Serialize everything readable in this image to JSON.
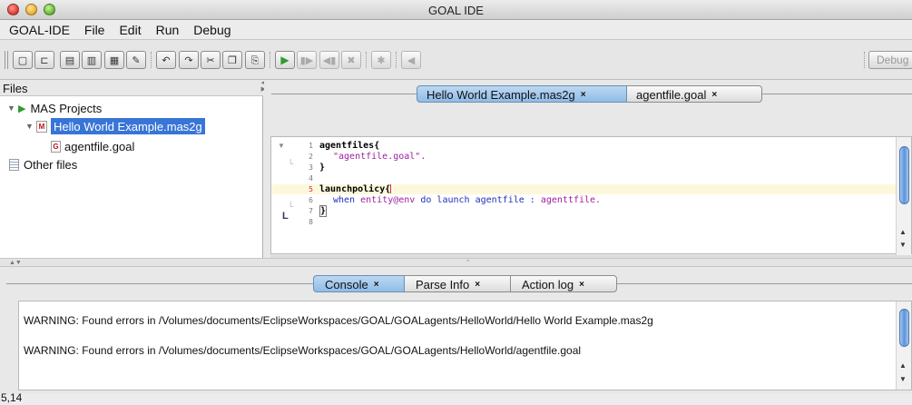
{
  "window": {
    "title": "GOAL IDE"
  },
  "menubar": {
    "items": [
      "GOAL-IDE",
      "File",
      "Edit",
      "Run",
      "Debug"
    ]
  },
  "toolbar": {
    "buttons": [
      {
        "icon": "new-file-icon",
        "glyph": "▢"
      },
      {
        "icon": "open-folder-icon",
        "glyph": "⊏"
      },
      {
        "icon": "save-icon",
        "glyph": "▤"
      },
      {
        "icon": "save-as-icon",
        "glyph": "▥"
      },
      {
        "icon": "save-all-icon",
        "glyph": "▦"
      },
      {
        "icon": "edit-icon",
        "glyph": "✎"
      },
      {
        "icon": "undo-icon",
        "glyph": "↶"
      },
      {
        "icon": "redo-icon",
        "glyph": "↷"
      },
      {
        "icon": "cut-icon",
        "glyph": "✂"
      },
      {
        "icon": "copy-icon",
        "glyph": "❐"
      },
      {
        "icon": "paste-icon",
        "glyph": "⎘"
      },
      {
        "icon": "run-icon",
        "glyph": "▶"
      },
      {
        "icon": "step-icon",
        "glyph": "▮▶"
      },
      {
        "icon": "back-step-icon",
        "glyph": "◀▮"
      },
      {
        "icon": "kill-icon",
        "glyph": "✖"
      },
      {
        "icon": "debug-bug-icon",
        "glyph": "✱"
      },
      {
        "icon": "rewind-icon",
        "glyph": "◀"
      }
    ],
    "debug_label": "Debug"
  },
  "files_panel": {
    "header": "Files",
    "mas_projects_label": "MAS Projects",
    "mas_file": "Hello World Example.mas2g",
    "goal_file": "agentfile.goal",
    "other_files_label": "Other files"
  },
  "editor": {
    "tabs": [
      {
        "label": "Hello World Example.mas2g",
        "close": "×",
        "active": true
      },
      {
        "label": "agentfile.goal",
        "close": "×",
        "active": false
      }
    ],
    "line_numbers": [
      "1",
      "2",
      "3",
      "4",
      "5",
      "6",
      "7",
      "8"
    ],
    "code": {
      "l1": "agentfiles{",
      "l2": "\"agentfile.goal\".",
      "l3": "}",
      "l5": "launchpolicy{",
      "l6_kw": "when",
      "l6_ent": "entity@env",
      "l6_rest": "do launch agentfile :",
      "l6_end": "agenttfile.",
      "l7": "}"
    },
    "colors": {
      "string": "#a020a0",
      "keyword2": "#1f2fbf",
      "highlight_line": "#fdf8dd"
    }
  },
  "console": {
    "tabs": [
      {
        "label": "Console",
        "close": "×",
        "active": true
      },
      {
        "label": "Parse Info",
        "close": "×",
        "active": false
      },
      {
        "label": "Action log",
        "close": "×",
        "active": false
      }
    ],
    "lines": [
      "WARNING: Found errors in /Volumes/documents/EclipseWorkspaces/GOAL/GOALagents/HelloWorld/Hello World Example.mas2g",
      "WARNING: Found errors in /Volumes/documents/EclipseWorkspaces/GOAL/GOALagents/HelloWorld/agentfile.goal"
    ]
  },
  "status": {
    "cursor_position": "5,14"
  }
}
